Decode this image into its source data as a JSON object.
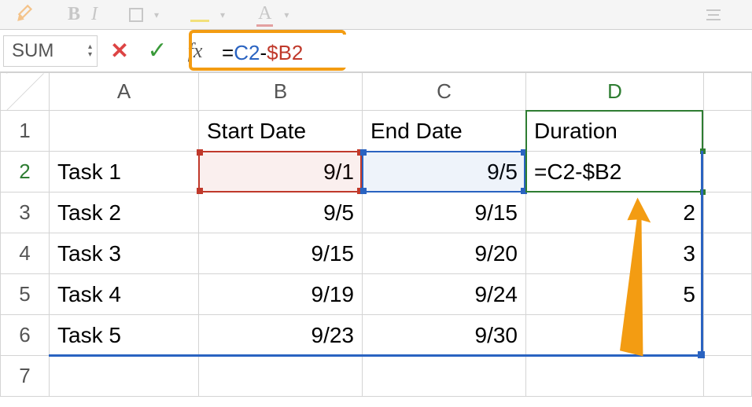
{
  "ribbon": {
    "bold": "B",
    "italic": "I",
    "fontA": "A"
  },
  "nameBox": "SUM",
  "formula": {
    "eq": "=",
    "c2": "C2",
    "minus": "-",
    "b2": "$B2"
  },
  "columns": [
    "A",
    "B",
    "C",
    "D"
  ],
  "rows": [
    "1",
    "2",
    "3",
    "4",
    "5",
    "6",
    "7"
  ],
  "headers": {
    "B": "Start Date",
    "C": "End Date",
    "D": "Duration"
  },
  "data": {
    "r2": {
      "A": "Task 1",
      "B": "9/1",
      "C": "9/5",
      "D": "=C2-$B2"
    },
    "r3": {
      "A": "Task 2",
      "B": "9/5",
      "C": "9/15",
      "D": "2"
    },
    "r4": {
      "A": "Task 3",
      "B": "9/15",
      "C": "9/20",
      "D": "3"
    },
    "r5": {
      "A": "Task 4",
      "B": "9/19",
      "C": "9/24",
      "D": "5"
    },
    "r6": {
      "A": "Task 5",
      "B": "9/23",
      "C": "9/30",
      "D": ""
    }
  }
}
